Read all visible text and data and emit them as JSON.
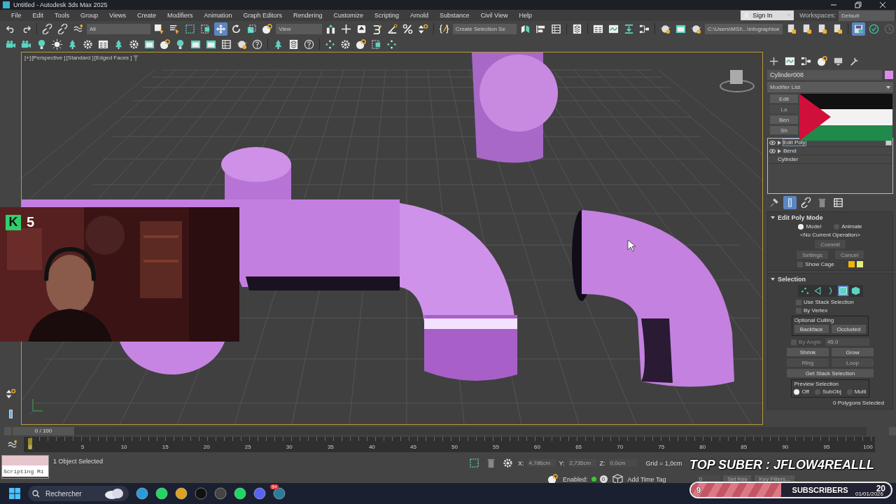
{
  "window": {
    "title": "Untitled - Autodesk 3ds Max 2025"
  },
  "menu": [
    "File",
    "Edit",
    "Tools",
    "Group",
    "Views",
    "Create",
    "Modifiers",
    "Animation",
    "Graph Editors",
    "Rendering",
    "Customize",
    "Scripting",
    "Arnold",
    "Substance",
    "Civil View",
    "Help"
  ],
  "account": {
    "sign_in": "Sign In",
    "workspaces_label": "Workspaces:",
    "workspace": "Default"
  },
  "toolbar": {
    "filter": "All",
    "coordinate_system": "View",
    "selection_set": "Create Selection Se",
    "project_path": "C:\\Users\\MSI\\...\\infographioe"
  },
  "viewport": {
    "labels": [
      "[+]",
      "[Perspective ]",
      "[Standard ]",
      "[Edged Faces ]"
    ]
  },
  "webcam": {
    "kind": "picture",
    "badge": "K",
    "count": "5"
  },
  "command_panel": {
    "object": {
      "name": "Cylinder008",
      "color": "#d98ce6"
    },
    "modifier_list": "Modifier List",
    "modifier_sets": [
      {
        "label": "Edit",
        "disabled": false
      },
      {
        "label": "La",
        "disabled": true
      },
      {
        "label": "Ben",
        "disabled": false
      },
      {
        "label": "Sh",
        "disabled": false
      }
    ],
    "stack": [
      {
        "label": "Edit Poly",
        "kind": "modifier",
        "selected": true
      },
      {
        "label": "Bend",
        "kind": "modifier",
        "selected": false
      },
      {
        "label": "Cylinder",
        "kind": "base",
        "selected": false
      }
    ],
    "edit_poly_mode": {
      "title": "Edit Poly Mode",
      "expanded": true,
      "modes": [
        {
          "label": "Model",
          "selected": true
        },
        {
          "label": "Animate",
          "selected": false
        }
      ],
      "operation": "<No Current Operation>",
      "commit": {
        "label": "Commit",
        "disabled": true
      },
      "settings": {
        "label": "Settings",
        "disabled": true
      },
      "cancel": {
        "label": "Cancel",
        "disabled": true
      },
      "show_cage": {
        "label": "Show Cage",
        "checked": false
      },
      "cage_colors": [
        {
          "color": "#f2b600"
        },
        {
          "color": "#e2f07c"
        }
      ]
    },
    "selection": {
      "title": "Selection",
      "expanded": true,
      "levels": [
        {
          "kind": "vertex",
          "selected": false
        },
        {
          "kind": "edge",
          "selected": false
        },
        {
          "kind": "border",
          "selected": false
        },
        {
          "kind": "polygon",
          "selected": true
        },
        {
          "kind": "element",
          "selected": false
        }
      ],
      "use_stack": {
        "label": "Use Stack Selection",
        "checked": false
      },
      "by_vertex": {
        "label": "By Vertex",
        "checked": false
      },
      "culling": {
        "title": "Optional Culling",
        "buttons": [
          "Backface",
          "Occluded"
        ]
      },
      "by_angle": {
        "label": "By Angle:",
        "value": "45.0",
        "checked": false,
        "disabled": true
      },
      "grow_shrink": [
        "Shrink",
        "Grow"
      ],
      "ring": {
        "label": "Ring",
        "disabled": true
      },
      "loop": {
        "label": "Loop",
        "disabled": true
      },
      "get_stack": "Get Stack Selection",
      "preview": {
        "title": "Preview Selection",
        "options": [
          {
            "label": "Off",
            "selected": true
          },
          {
            "label": "SubObj",
            "selected": false
          },
          {
            "label": "Multi",
            "selected": false
          }
        ]
      },
      "status": "0 Polygons Selected"
    }
  },
  "timeline": {
    "frame": "0 / 100",
    "level": 0,
    "current": "0",
    "ticks": [
      "5",
      "10",
      "15",
      "20",
      "25",
      "30",
      "35",
      "40",
      "45",
      "50",
      "55",
      "60",
      "65",
      "70",
      "75",
      "80",
      "85",
      "90",
      "95",
      "100"
    ]
  },
  "status_bar": {
    "script_field": "Scripting Mi",
    "selected": "1 Object Selected",
    "x_label": "X:",
    "x": "4,786cm",
    "y_label": "Y:",
    "y": "2,735cm",
    "z_label": "Z:",
    "z": "0,0cm",
    "grid": "Grid = 1,0cm",
    "enabled_label": "Enabled:",
    "time_tag_count": "0",
    "add_time_tag": "Add Time Tag",
    "frame": "0",
    "set_key": "Set Key",
    "key_filters": "Key Filters..."
  },
  "overlay": {
    "top_suber": "TOP SUBER : JFLOW4REALLL",
    "goal": {
      "current": "9",
      "label": "SUBSCRIBERS",
      "target": "20",
      "level": 0.45
    }
  },
  "taskbar": {
    "search": "Rechercher",
    "discord_badge": "9+",
    "date": "01/01/2026"
  }
}
